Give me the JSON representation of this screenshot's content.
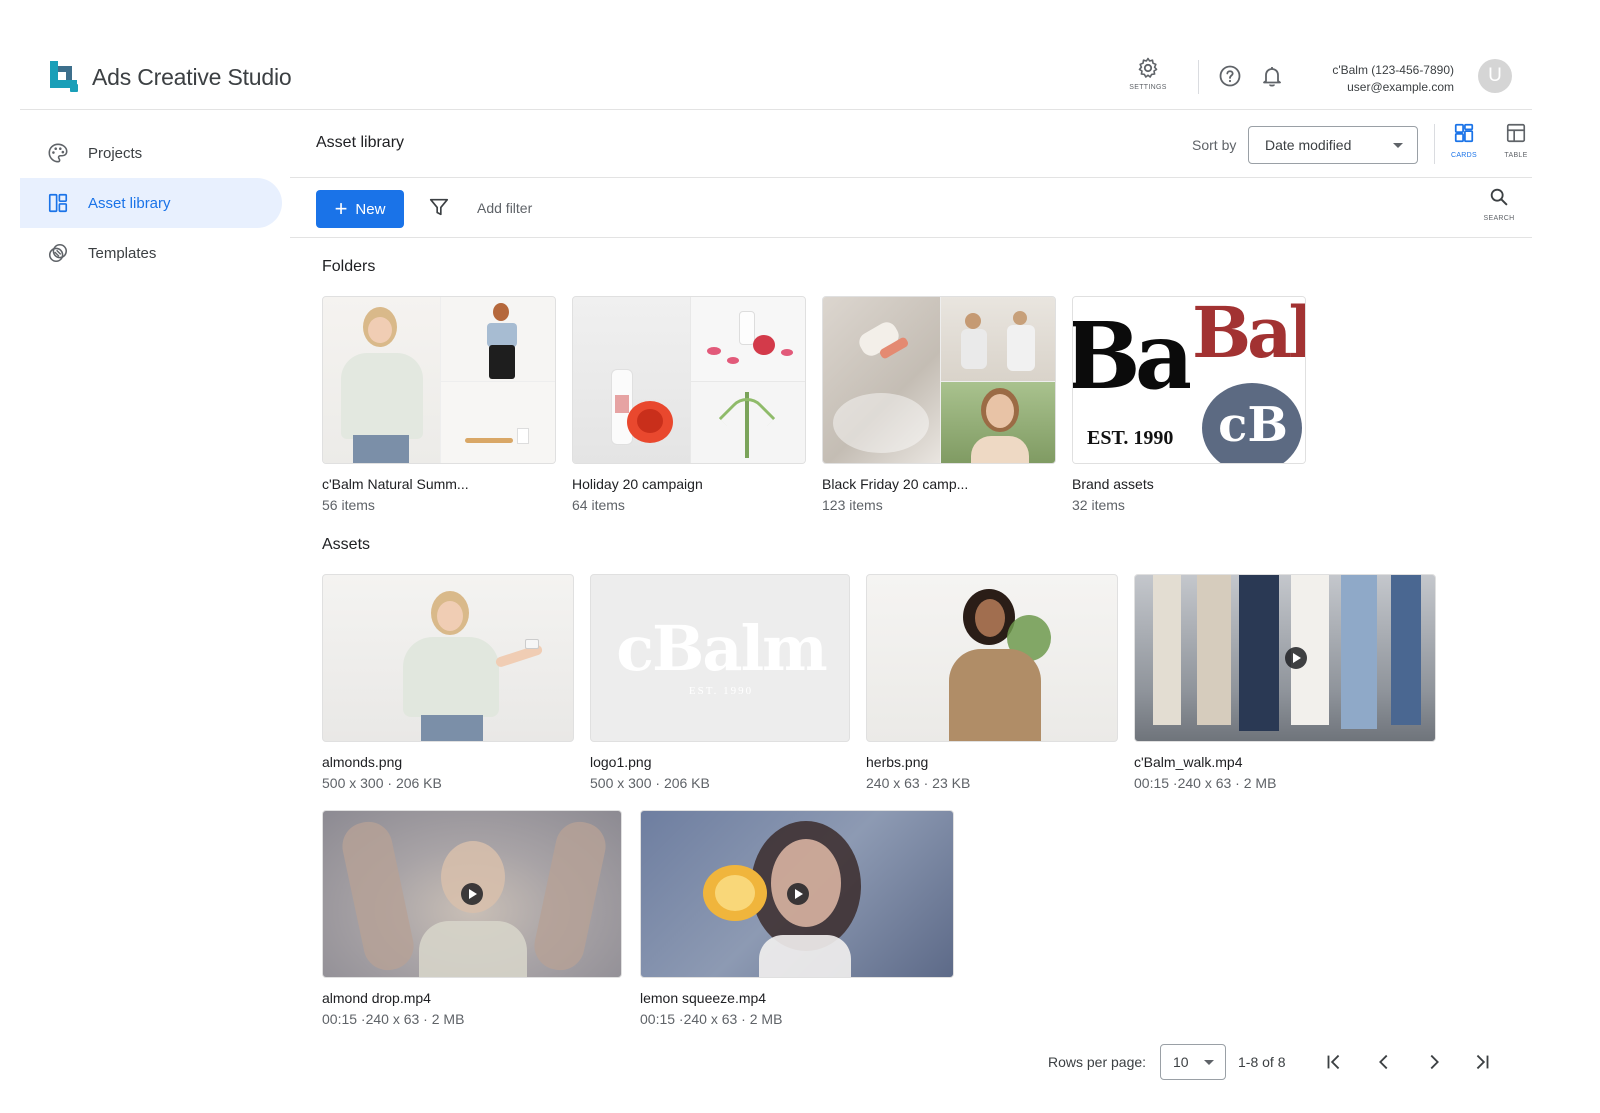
{
  "app": {
    "title": "Ads Creative Studio",
    "settings_caption": "SETTINGS",
    "account_name": "c'Balm (123-456-7890)",
    "account_email": "user@example.com",
    "avatar_letter": "U",
    "accent_color": "#1a73e8"
  },
  "sidebar": {
    "items": [
      {
        "label": "Projects",
        "icon": "palette-icon",
        "active": false
      },
      {
        "label": "Asset library",
        "icon": "dashboard-icon",
        "active": true
      },
      {
        "label": "Templates",
        "icon": "layers-icon",
        "active": false
      }
    ]
  },
  "toolbar": {
    "page_title": "Asset library",
    "sort_label": "Sort by",
    "sort_value": "Date modified",
    "cards_caption": "CARDS",
    "table_caption": "TABLE",
    "new_label": "New",
    "add_filter": "Add filter",
    "search_caption": "SEARCH"
  },
  "folders": {
    "title": "Folders",
    "items": [
      {
        "name": "c'Balm Natural Summ...",
        "count": "56 items"
      },
      {
        "name": "Holiday 20 campaign",
        "count": "64 items"
      },
      {
        "name": "Black Friday 20 camp...",
        "count": "123 items"
      },
      {
        "name": "Brand assets",
        "count": "32 items"
      }
    ],
    "brand_text_1": "Bal",
    "brand_text_2": "Bal",
    "brand_est": "EST. 1990",
    "brand_cb": "cB"
  },
  "assets": {
    "title": "Assets",
    "logo_text": "cBalm",
    "logo_est": "EST. 1990",
    "items": [
      {
        "name": "almonds.png",
        "meta": "500 x 300 · 206 KB",
        "type": "image"
      },
      {
        "name": "logo1.png",
        "meta": "500 x 300 · 206 KB",
        "type": "image"
      },
      {
        "name": "herbs.png",
        "meta": "240 x 63 · 23 KB",
        "type": "image"
      },
      {
        "name": "c'Balm_walk.mp4",
        "meta": "00:15 ·240 x 63 · 2 MB",
        "type": "video"
      },
      {
        "name": "almond drop.mp4",
        "meta": "00:15 ·240 x 63 · 2 MB",
        "type": "video"
      },
      {
        "name": "lemon squeeze.mp4",
        "meta": "00:15 ·240 x 63 · 2 MB",
        "type": "video"
      }
    ]
  },
  "pagination": {
    "rows_label": "Rows per page:",
    "rows_value": "10",
    "range": "1-8 of 8"
  }
}
